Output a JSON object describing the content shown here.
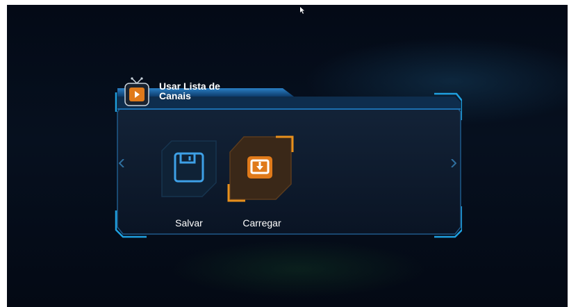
{
  "dialog": {
    "title": "Usar Lista de Canais",
    "title_line1": "Usar Lista de",
    "title_line2": "Canais",
    "icon": "tv-play-icon"
  },
  "options": [
    {
      "label": "Salvar",
      "icon": "floppy-disk-icon",
      "selected": false
    },
    {
      "label": "Carregar",
      "icon": "download-tray-icon",
      "selected": true
    }
  ],
  "nav": {
    "left_icon": "chevron-left-icon",
    "right_icon": "chevron-right-icon"
  },
  "colors": {
    "accent_blue": "#2a8fd6",
    "accent_orange": "#e8901c",
    "panel_bg": "#0c1626"
  }
}
